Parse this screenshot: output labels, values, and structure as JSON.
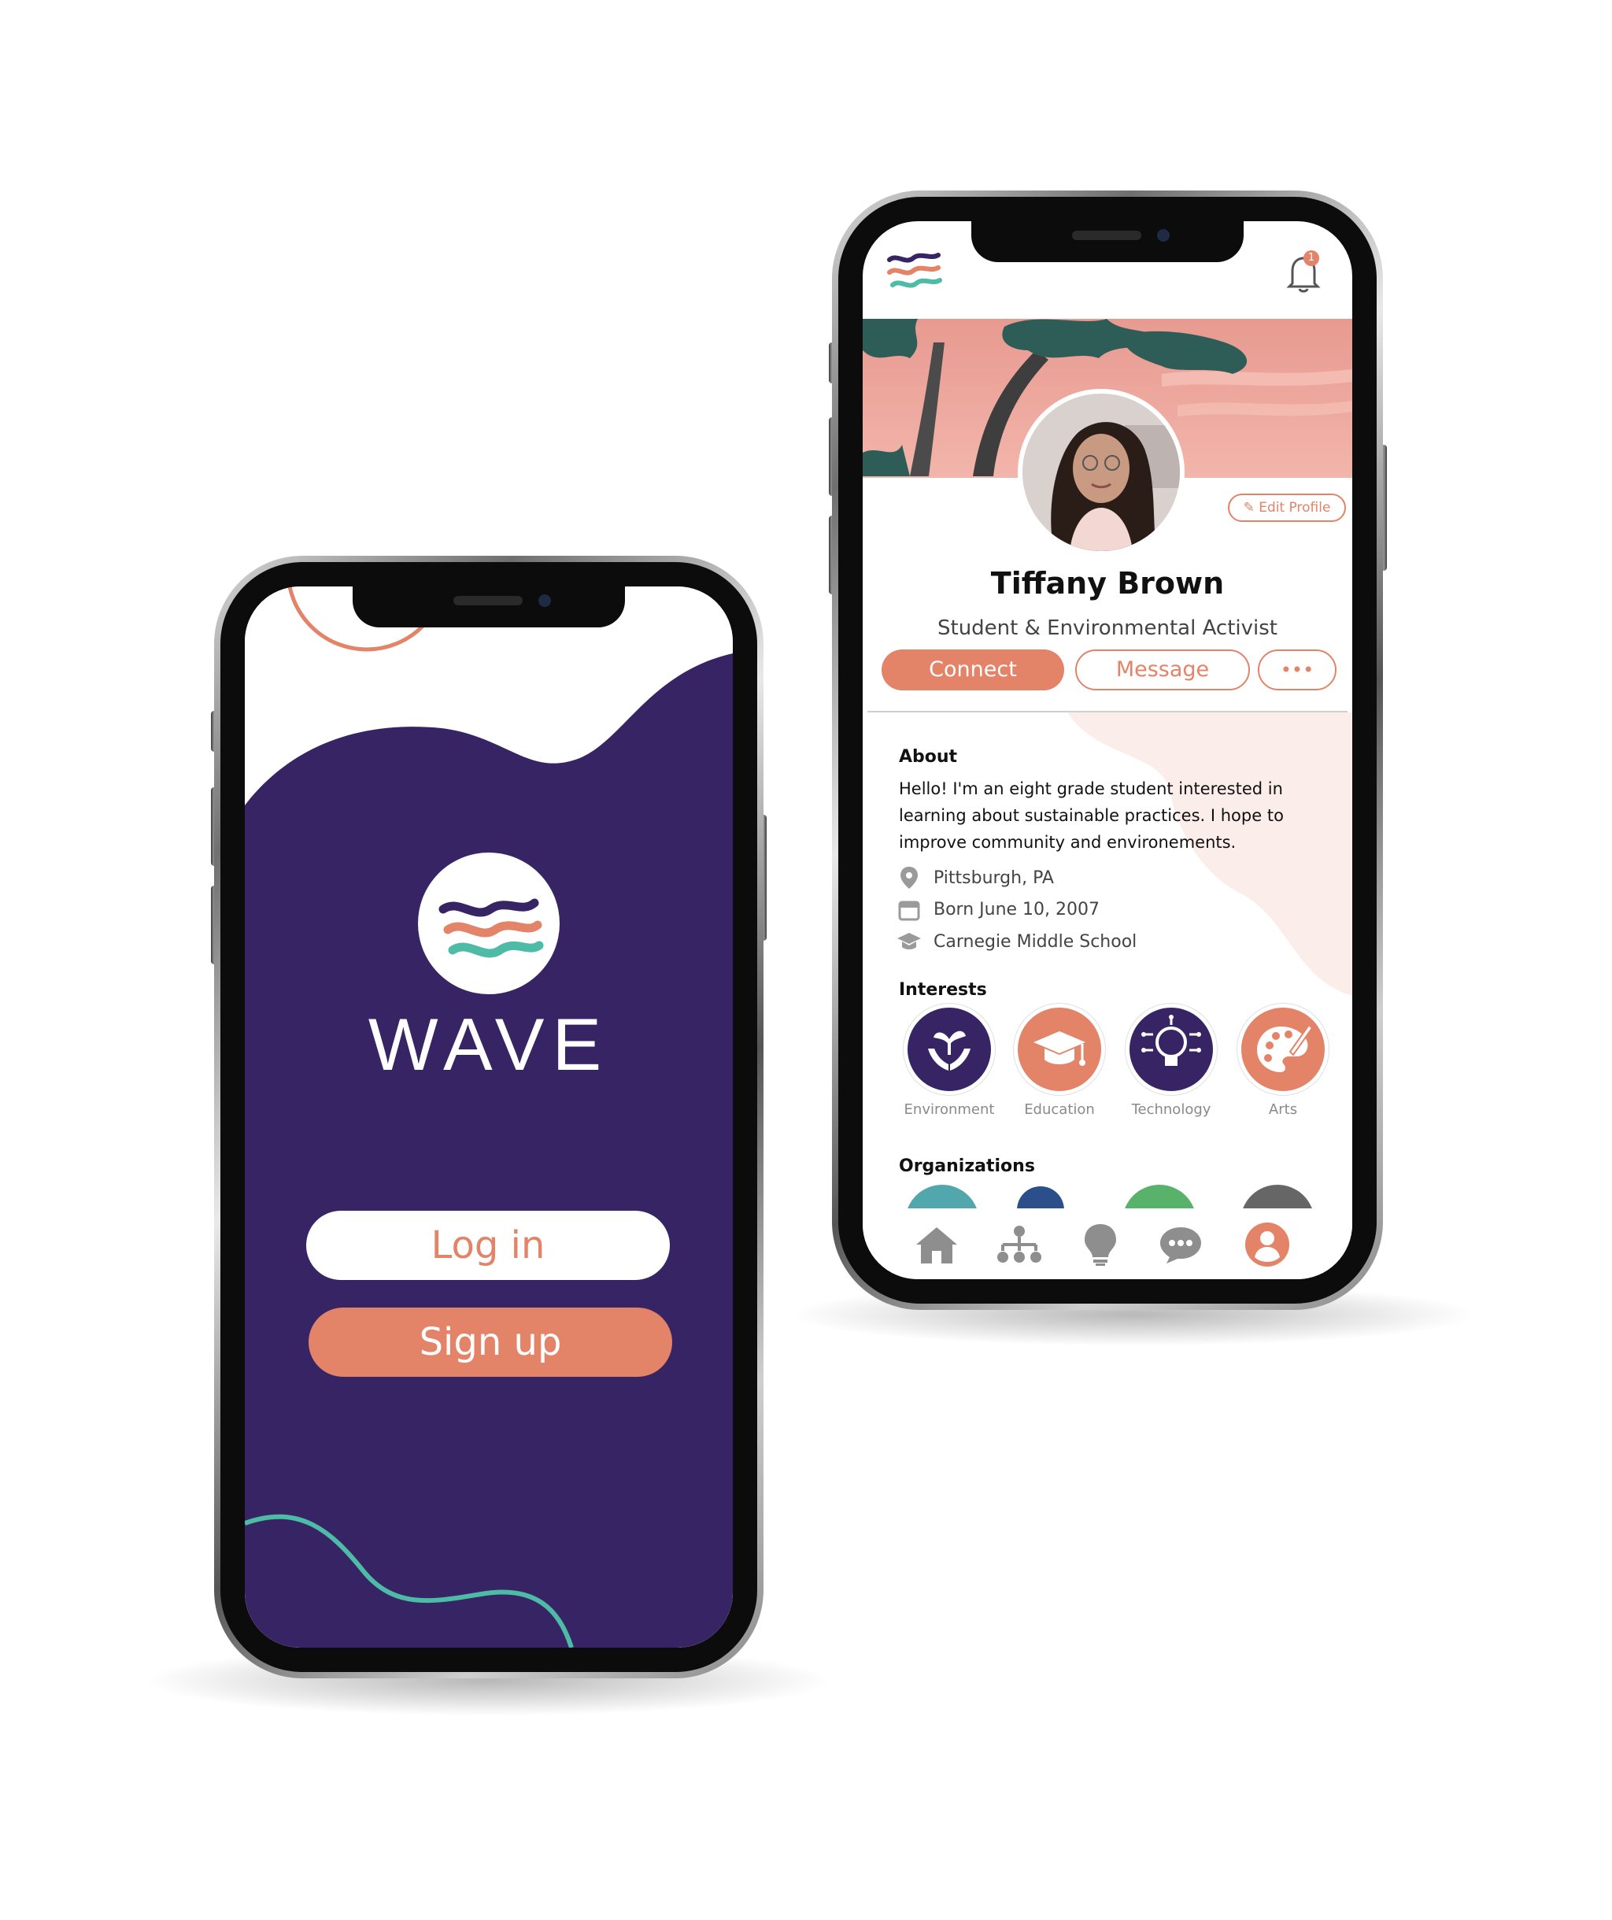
{
  "login_screen": {
    "app_name": "WAVE",
    "login_label": "Log in",
    "signup_label": "Sign up"
  },
  "profile_screen": {
    "notification_count": "1",
    "edit_profile_label": "Edit Profile",
    "name": "Tiffany Brown",
    "headline": "Student & Environmental Activist",
    "connect_label": "Connect",
    "message_label": "Message",
    "more_label": "•••",
    "about_heading": "About",
    "about_text_line1": "Hello! I'm an eight grade student interested in",
    "about_text_line2": "learning about sustainable practices. I hope to",
    "about_text_line3": "improve community and environements.",
    "location": "Pittsburgh, PA",
    "birthday": "Born June 10, 2007",
    "school": "Carnegie Middle School",
    "interests_heading": "Interests",
    "interests": [
      {
        "label": "Environment",
        "icon": "plant-hands-icon"
      },
      {
        "label": "Education",
        "icon": "graduation-cap-icon"
      },
      {
        "label": "Technology",
        "icon": "lightbulb-circuit-icon"
      },
      {
        "label": "Arts",
        "icon": "palette-icon"
      }
    ],
    "organizations_heading": "Organizations",
    "bottom_nav": [
      "home-icon",
      "network-icon",
      "lightbulb-icon",
      "chat-icon",
      "profile-icon"
    ]
  },
  "colors": {
    "purple": "#372464",
    "coral": "#e38368",
    "teal": "#4dbba5",
    "cream": "#fbeeea"
  }
}
